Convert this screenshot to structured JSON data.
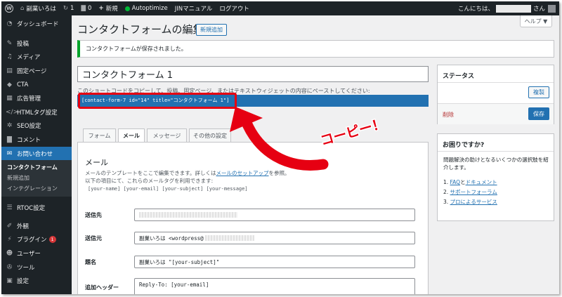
{
  "admin_bar": {
    "site_name": "副業いろは",
    "update_count": "1",
    "comment_count": "0",
    "new_label": "新規",
    "autoptimize": "Autoptimize",
    "jin_manual": "JINマニュアル",
    "logout": "ログアウト",
    "greeting": "こんにちは、",
    "greeting_suffix": "さん",
    "icons": [
      "wordpress-icon",
      "home-icon",
      "refresh-icon",
      "comment-icon",
      "plus-icon",
      "status-dot-icon"
    ]
  },
  "sidebar": {
    "dashboard": "ダッシュボード",
    "items": [
      {
        "label": "投稿",
        "icon": "pin-icon"
      },
      {
        "label": "メディア",
        "icon": "media-icon"
      },
      {
        "label": "固定ページ",
        "icon": "page-icon"
      },
      {
        "label": "CTA",
        "icon": "tag-icon"
      },
      {
        "label": "広告管理",
        "icon": "ad-icon"
      },
      {
        "label": "HTMLタグ設定",
        "icon": "code-icon"
      },
      {
        "label": "SEO設定",
        "icon": "gear-icon"
      },
      {
        "label": "コメント",
        "icon": "comment-icon"
      }
    ],
    "active": "お問い合わせ",
    "submenu": [
      "コンタクトフォーム",
      "新規追加",
      "インテグレーション"
    ],
    "rtoc": "RTOC設定",
    "bottom_items": [
      {
        "label": "外観",
        "icon": "brush-icon"
      },
      {
        "label": "プラグイン",
        "icon": "plugin-icon",
        "badge": "1"
      },
      {
        "label": "ユーザー",
        "icon": "user-icon"
      },
      {
        "label": "ツール",
        "icon": "wrench-icon"
      },
      {
        "label": "設定",
        "icon": "settings-icon"
      }
    ]
  },
  "main": {
    "help_tab": "ヘルプ ▼",
    "page_title": "コンタクトフォームの編集",
    "add_new": "新規追加",
    "notice": "コンタクトフォームが保存されました。",
    "form_title": "コンタクトフォーム 1",
    "shortcode_desc": "このショートコードをコピーして、投稿、固定ページ、またはテキストウィジェットの内容にペーストしてください:",
    "shortcode": "[contact-form-7 id=\"14\" title=\"コンタクトフォーム 1\"]",
    "tabs": [
      "フォーム",
      "メール",
      "メッセージ",
      "その他の設定"
    ],
    "mail": {
      "heading": "メール",
      "desc_1": "メールのテンプレートをここで編集できます。詳しくは",
      "desc_link": "メールのセットアップ",
      "desc_2": "を参照。",
      "desc_3": "以下の項目にて、これらのメールタグを利用できます:",
      "tags": "[your-name] [your-email] [your-subject] [your-message]",
      "to_label": "送信先",
      "from_label": "送信元",
      "from_value": "副業いろは <wordpress@",
      "subject_label": "題名",
      "subject_value": "副業いろは \"[your-subject]\"",
      "headers_label": "追加ヘッダー",
      "headers_value": "Reply-To: [your-email]"
    }
  },
  "status_box": {
    "title": "ステータス",
    "duplicate": "複製",
    "delete": "削除",
    "save": "保存"
  },
  "help_box": {
    "title": "お困りですか?",
    "desc": "問題解決の助けとなるいくつかの選択肢を紹介します。",
    "items": [
      {
        "num": "1. ",
        "link1": "FAQ",
        "mid": "と",
        "link2": "ドキュメント"
      },
      {
        "num": "2. ",
        "link1": "サポートフォーラム"
      },
      {
        "num": "3. ",
        "link1": "プロによるサービス"
      }
    ]
  },
  "annotation": {
    "label": "コーピー！",
    "color": "#e60012"
  }
}
